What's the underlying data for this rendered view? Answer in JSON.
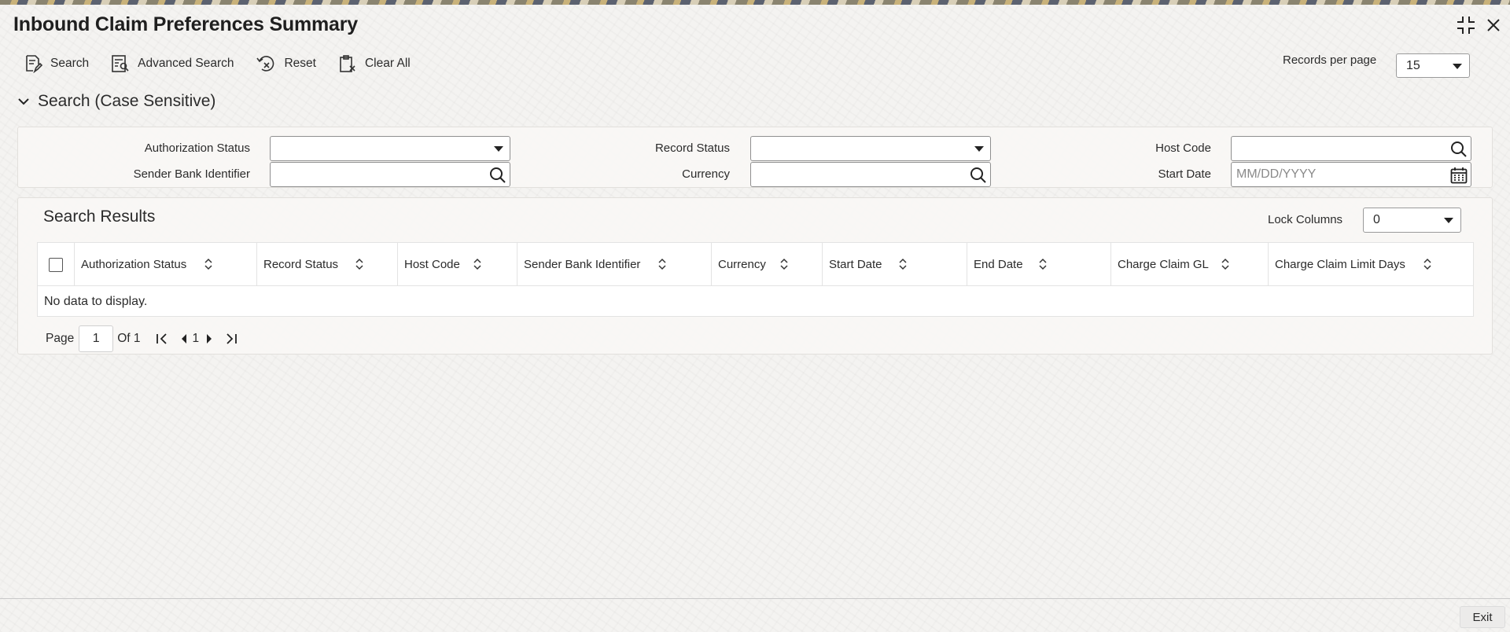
{
  "page": {
    "title": "Inbound Claim Preferences Summary"
  },
  "toolbar": {
    "search_label": "Search",
    "advanced_search_label": "Advanced Search",
    "reset_label": "Reset",
    "clear_all_label": "Clear All"
  },
  "records_per_page": {
    "label": "Records per page",
    "value": "15"
  },
  "search_section": {
    "title": "Search (Case Sensitive)",
    "fields": {
      "authorization_status": {
        "label": "Authorization Status",
        "value": ""
      },
      "record_status": {
        "label": "Record Status",
        "value": ""
      },
      "host_code": {
        "label": "Host Code",
        "value": ""
      },
      "sender_bank_identifier": {
        "label": "Sender Bank Identifier",
        "value": ""
      },
      "currency": {
        "label": "Currency",
        "value": ""
      },
      "start_date": {
        "label": "Start Date",
        "placeholder": "MM/DD/YYYY"
      }
    }
  },
  "results": {
    "title": "Search Results",
    "lock_columns": {
      "label": "Lock Columns",
      "value": "0"
    },
    "columns": [
      "Authorization Status",
      "Record Status",
      "Host Code",
      "Sender Bank Identifier",
      "Currency",
      "Start Date",
      "End Date",
      "Charge Claim GL",
      "Charge Claim Limit Days"
    ],
    "empty_text": "No data to display."
  },
  "pagination": {
    "page_label": "Page",
    "current_page": "1",
    "of_label": "Of 1",
    "page_link": "1"
  },
  "footer": {
    "exit_label": "Exit"
  },
  "icons": [
    "minimize-icon",
    "close-icon",
    "search-doc-icon",
    "advanced-search-icon",
    "reset-icon",
    "clear-all-icon",
    "chevron-down-icon",
    "magnifier-icon",
    "calendar-icon",
    "sort-icon",
    "first-page-icon",
    "prev-page-icon",
    "next-page-icon",
    "last-page-icon"
  ]
}
